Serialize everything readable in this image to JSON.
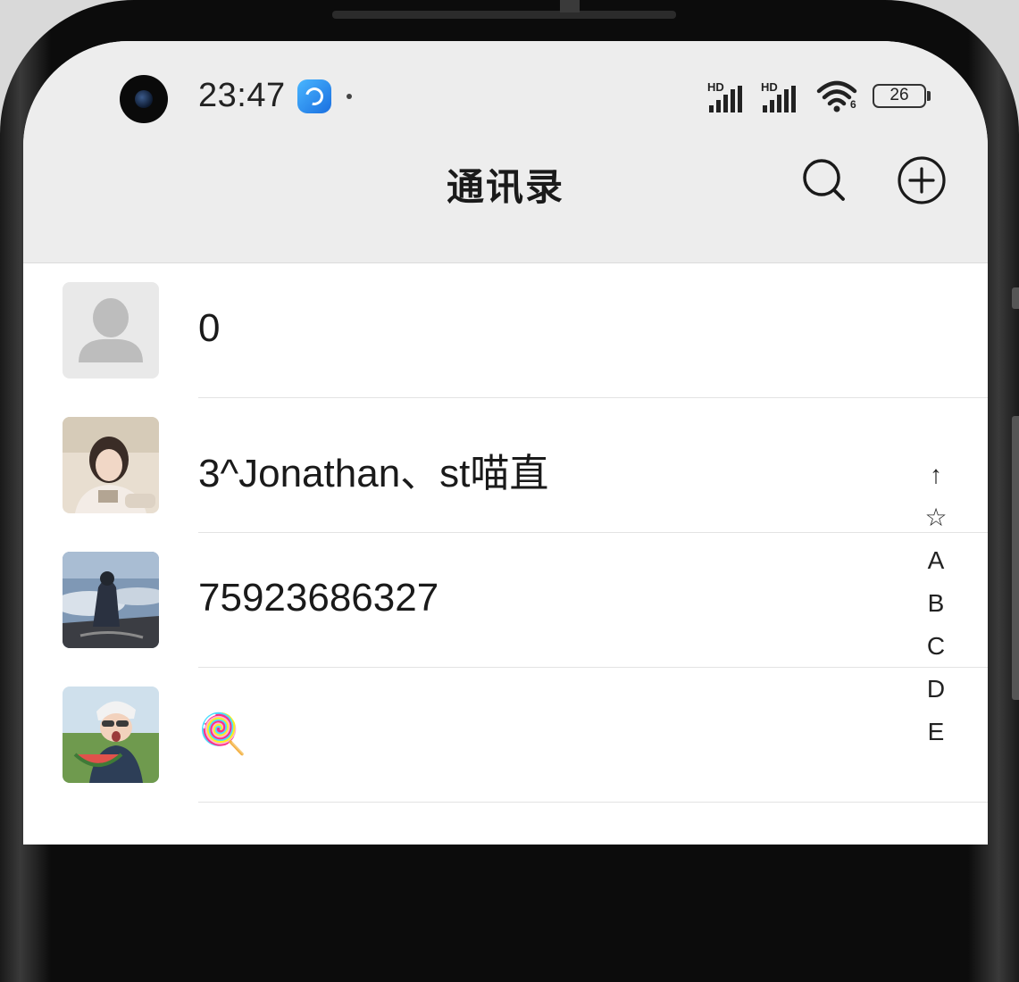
{
  "status_bar": {
    "time": "23:47",
    "signal_1_label": "HD",
    "signal_2_label": "HD",
    "wifi_label": "6",
    "battery": "26"
  },
  "header": {
    "title": "通讯录",
    "search_icon": "search-icon",
    "add_icon": "add-circle-icon"
  },
  "contacts": [
    {
      "name": "0",
      "avatar": "default-person-avatar"
    },
    {
      "name": "3^Jonathan、st喵直",
      "avatar": "photo-avatar-girl"
    },
    {
      "name": "75923686327",
      "avatar": "photo-avatar-landscape"
    },
    {
      "name": "🍭",
      "avatar": "photo-avatar-child"
    }
  ],
  "alphabet_index": [
    "↑",
    "☆",
    "A",
    "B",
    "C",
    "D",
    "E"
  ],
  "colors": {
    "header_bg": "#ededed",
    "list_bg": "#ffffff",
    "text": "#1a1a1a",
    "divider": "#e3e3e3"
  }
}
